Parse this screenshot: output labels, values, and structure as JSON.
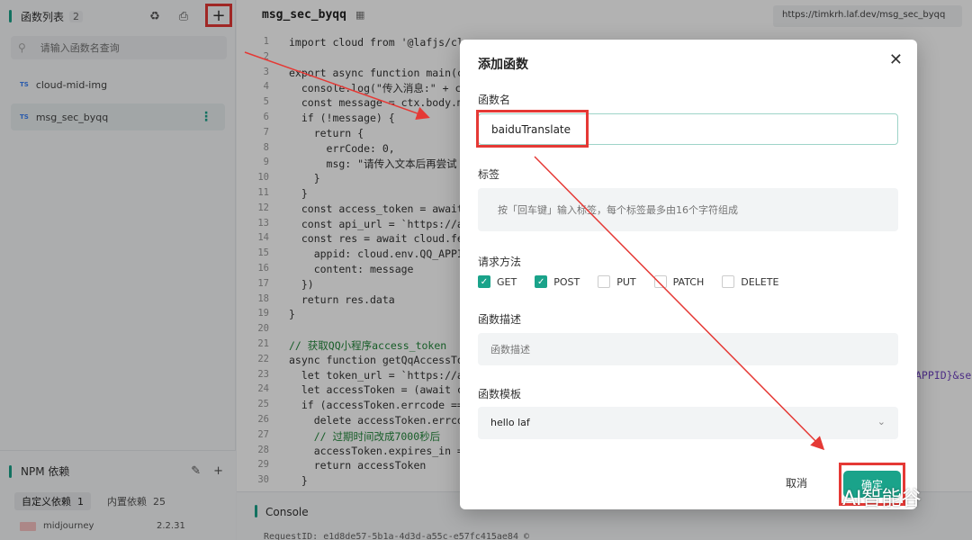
{
  "sidebar": {
    "title": "函数列表",
    "count": "2",
    "search_placeholder": "请输入函数名查询",
    "functions": [
      {
        "tag": "TS",
        "name": "cloud-mid-img"
      },
      {
        "tag": "TS",
        "name": "msg_sec_byqq"
      }
    ],
    "npm": {
      "title": "NPM 依赖",
      "tabs": [
        {
          "label": "自定义依赖",
          "count": "1"
        },
        {
          "label": "内置依赖",
          "count": "25"
        }
      ],
      "package": {
        "name": "midjourney",
        "version": "2.2.31"
      }
    }
  },
  "editor": {
    "file_name": "msg_sec_byqq",
    "url": "https://timkrh.laf.dev/msg_sec_byqq",
    "lines": [
      {
        "n": "1",
        "text": "import cloud from '@lafjs/cl",
        "color": "#333"
      },
      {
        "n": "2",
        "text": "",
        "color": "#333"
      },
      {
        "n": "3",
        "text": "export async function main(c",
        "color": "#333"
      },
      {
        "n": "4",
        "text": "  console.log(\"传入消息:\" + c",
        "color": "#333"
      },
      {
        "n": "5",
        "text": "  const message = ctx.body.m",
        "color": "#333"
      },
      {
        "n": "6",
        "text": "  if (!message) {",
        "color": "#333"
      },
      {
        "n": "7",
        "text": "    return {",
        "color": "#333"
      },
      {
        "n": "8",
        "text": "      errCode: 0,",
        "color": "#333"
      },
      {
        "n": "9",
        "text": "      msg: \"请传入文本后再尝试",
        "color": "#333"
      },
      {
        "n": "10",
        "text": "    }",
        "color": "#333"
      },
      {
        "n": "11",
        "text": "  }",
        "color": "#333"
      },
      {
        "n": "12",
        "text": "  const access_token = await",
        "color": "#333"
      },
      {
        "n": "13",
        "text": "  const api_url = `https://a",
        "color": "#333"
      },
      {
        "n": "14",
        "text": "  const res = await cloud.fe",
        "color": "#333"
      },
      {
        "n": "15",
        "text": "    appid: cloud.env.QQ_APPI",
        "color": "#333"
      },
      {
        "n": "16",
        "text": "    content: message",
        "color": "#333"
      },
      {
        "n": "17",
        "text": "  })",
        "color": "#333"
      },
      {
        "n": "18",
        "text": "  return res.data",
        "color": "#333"
      },
      {
        "n": "19",
        "text": "}",
        "color": "#333"
      },
      {
        "n": "20",
        "text": "",
        "color": "#333"
      },
      {
        "n": "21",
        "text": "// 获取QQ小程序access_token",
        "color": "#22863a"
      },
      {
        "n": "22",
        "text": "async function getQqAccessTo",
        "color": "#333"
      },
      {
        "n": "23",
        "text": "  let token_url = `https://a",
        "color": "#333"
      },
      {
        "n": "24",
        "text": "  let accessToken = (await c",
        "color": "#333"
      },
      {
        "n": "25",
        "text": "  if (accessToken.errcode ==",
        "color": "#333"
      },
      {
        "n": "26",
        "text": "    delete accessToken.errco",
        "color": "#333"
      },
      {
        "n": "27",
        "text": "    // 过期时间改成7000秒后",
        "color": "#22863a"
      },
      {
        "n": "28",
        "text": "    accessToken.expires_in =",
        "color": "#333"
      },
      {
        "n": "29",
        "text": "    return accessToken",
        "color": "#333"
      },
      {
        "n": "30",
        "text": "  }",
        "color": "#333"
      }
    ],
    "overflow_text": "APPID}&se"
  },
  "console": {
    "title": "Console",
    "request_id": "RequestID: e1d8de57-5b1a-4d3d-a55c-e57fc415ae84 ©"
  },
  "dialog": {
    "title": "添加函数",
    "name_label": "函数名",
    "name_value": "baiduTranslate",
    "tags_label": "标签",
    "tags_placeholder": "按「回车键」输入标签，每个标签最多由16个字符组成",
    "methods_label": "请求方法",
    "methods": [
      {
        "label": "GET",
        "checked": true
      },
      {
        "label": "POST",
        "checked": true
      },
      {
        "label": "PUT",
        "checked": false
      },
      {
        "label": "PATCH",
        "checked": false
      },
      {
        "label": "DELETE",
        "checked": false
      }
    ],
    "desc_label": "函数描述",
    "desc_placeholder": "函数描述",
    "template_label": "函数模板",
    "template_value": "hello laf",
    "cancel_label": "取消",
    "confirm_label": "确定"
  },
  "watermark": "AI智能谷",
  "colors": {
    "accent": "#1aa38a",
    "annotation": "#e53935"
  }
}
